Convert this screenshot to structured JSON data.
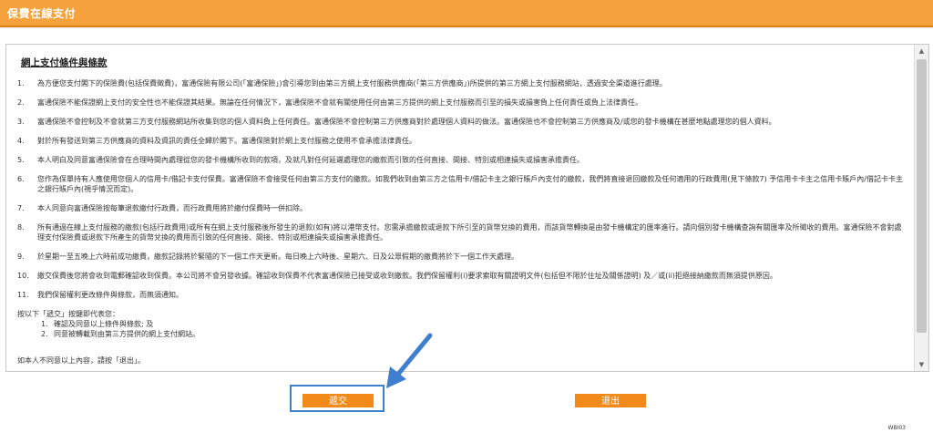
{
  "header": {
    "title": "保費在線支付"
  },
  "terms": {
    "heading": "網上支付條件與條款",
    "clauses": [
      {
        "num": "1.",
        "text": "為方便您支付閣下的保險費(包括保費徵費)，富通保險有限公司(「富通保險」)會引導您到由第三方網上支付服務供應商(「第三方供應商」)所提供的第三方網上支付服務網站，透過安全渠道進行處理。"
      },
      {
        "num": "2.",
        "text": "富通保險不能保證網上支付的安全性也不能保證其結果。無論在任何情況下，富通保險不會就有關使用任何由第三方提供的網上支付服務而引至的損失或損害負上任何責任或負上法律責任。"
      },
      {
        "num": "3.",
        "text": "富通保險不會控制及不會就第三方支付服務網站所收集到您的個人資料負上任何責任。富通保險不會控制第三方供應商對於處理個人資料的做法。富通保險也不會控制第三方供應商及/或您的發卡機構在甚麼地點處理您的個人資料。"
      },
      {
        "num": "4.",
        "text": "對於所有發送到第三方供應商的資料及資訊的責任全歸於閣下。富通保險對於網上支付服務之使用不會承擔法律責任。"
      },
      {
        "num": "5.",
        "text": "本人明白及同意富通保險會在合理時間內處理從您的發卡機構所收到的款項，及就凡對任何延遲處理您的繳款而引致的任何直接、間接、特別或相連損失或損害承擔責任。"
      },
      {
        "num": "6.",
        "text": "您作為保單持有人應使用您個人的信用卡/借記卡支付保費。富通保險不會接受任何由第三方支付的繳款。如我們收到由第三方之信用卡/借記卡主之銀行賬戶內支付的繳款，我們將直接退回繳款及任何適用的行政費用(見下條款7) 予信用卡卡主之信用卡賬戶內/借記卡卡主之銀行賬戶內(視乎情況而定)。"
      },
      {
        "num": "7.",
        "text": "本人同意向富通保險按每筆退款繳付行政費，而行政費用將於繳付保費時一併扣除。"
      },
      {
        "num": "8.",
        "text": "所有通過在線上支付服務的繳款(包括行政費用)或所有在網上支付服務後所發生的退款(如有)將以港幣支付。您需承擔繳款或退款下所引至的貨幣兌換的費用，而該貨幣轉換是由發卡機構定的匯率進行。請向個別發卡機構查詢有關匯率及所徵收的費用。富通保險不會對處理支付保險費或退款下所產生的貨幣兌換的費用而引致的任何直接、間接、特別或相連損失或損害承擔責任。"
      },
      {
        "num": "9.",
        "text": "於星期一至五晚上六時前成功繳費，繳款記錄將於緊隨的下一個工作天更新。每日晚上六時後、星期六、日及公眾假期的繳費將於下一個工作天處理。"
      },
      {
        "num": "10.",
        "text": "繳交保費後您將會收到電郵確認收到保費。本公司將不會另發收據。確認收到保費不代表富通保險已接受或收到繳款。我們保留權利(i)要求索取有關證明文件(包括但不限於住址及關係證明) 及／或(ii)拒絕接納繳款而無須提供原因。"
      },
      {
        "num": "11.",
        "text": "我們保留權利更改條件與條款，而無須通知。"
      }
    ],
    "confirm_intro": "按以下「遞交」按鍵即代表您：",
    "confirm_items": [
      {
        "num": "1.",
        "text": "確認及同意以上條件與條款; 及"
      },
      {
        "num": "2.",
        "text": "同意被轉載到由第三方提供的網上支付網站。"
      }
    ],
    "footer_note": "如本人不同意以上內容，請按「退出」。"
  },
  "buttons": {
    "submit": "遞交",
    "exit": "退出"
  },
  "page_code": "WBI03",
  "colors": {
    "header": "#f6a23c",
    "button": "#f28a1a",
    "highlight": "#3f7fd0"
  }
}
